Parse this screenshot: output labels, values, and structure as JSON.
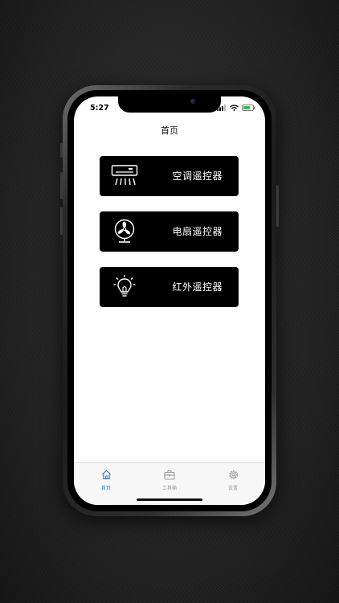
{
  "status_bar": {
    "time": "5:27"
  },
  "header": {
    "title": "首页"
  },
  "cards": [
    {
      "label": "空调遥控器",
      "icon": "air-conditioner-icon"
    },
    {
      "label": "电扇遥控器",
      "icon": "fan-icon"
    },
    {
      "label": "红外遥控器",
      "icon": "light-bulb-icon"
    }
  ],
  "tabs": [
    {
      "label": "首页",
      "icon": "home-icon",
      "active": true
    },
    {
      "label": "工具箱",
      "icon": "toolbox-icon",
      "active": false
    },
    {
      "label": "设置",
      "icon": "gear-icon",
      "active": false
    }
  ],
  "colors": {
    "active_tab": "#2f7de1",
    "inactive_tab": "#9a9a9a",
    "card_bg": "#000000"
  }
}
